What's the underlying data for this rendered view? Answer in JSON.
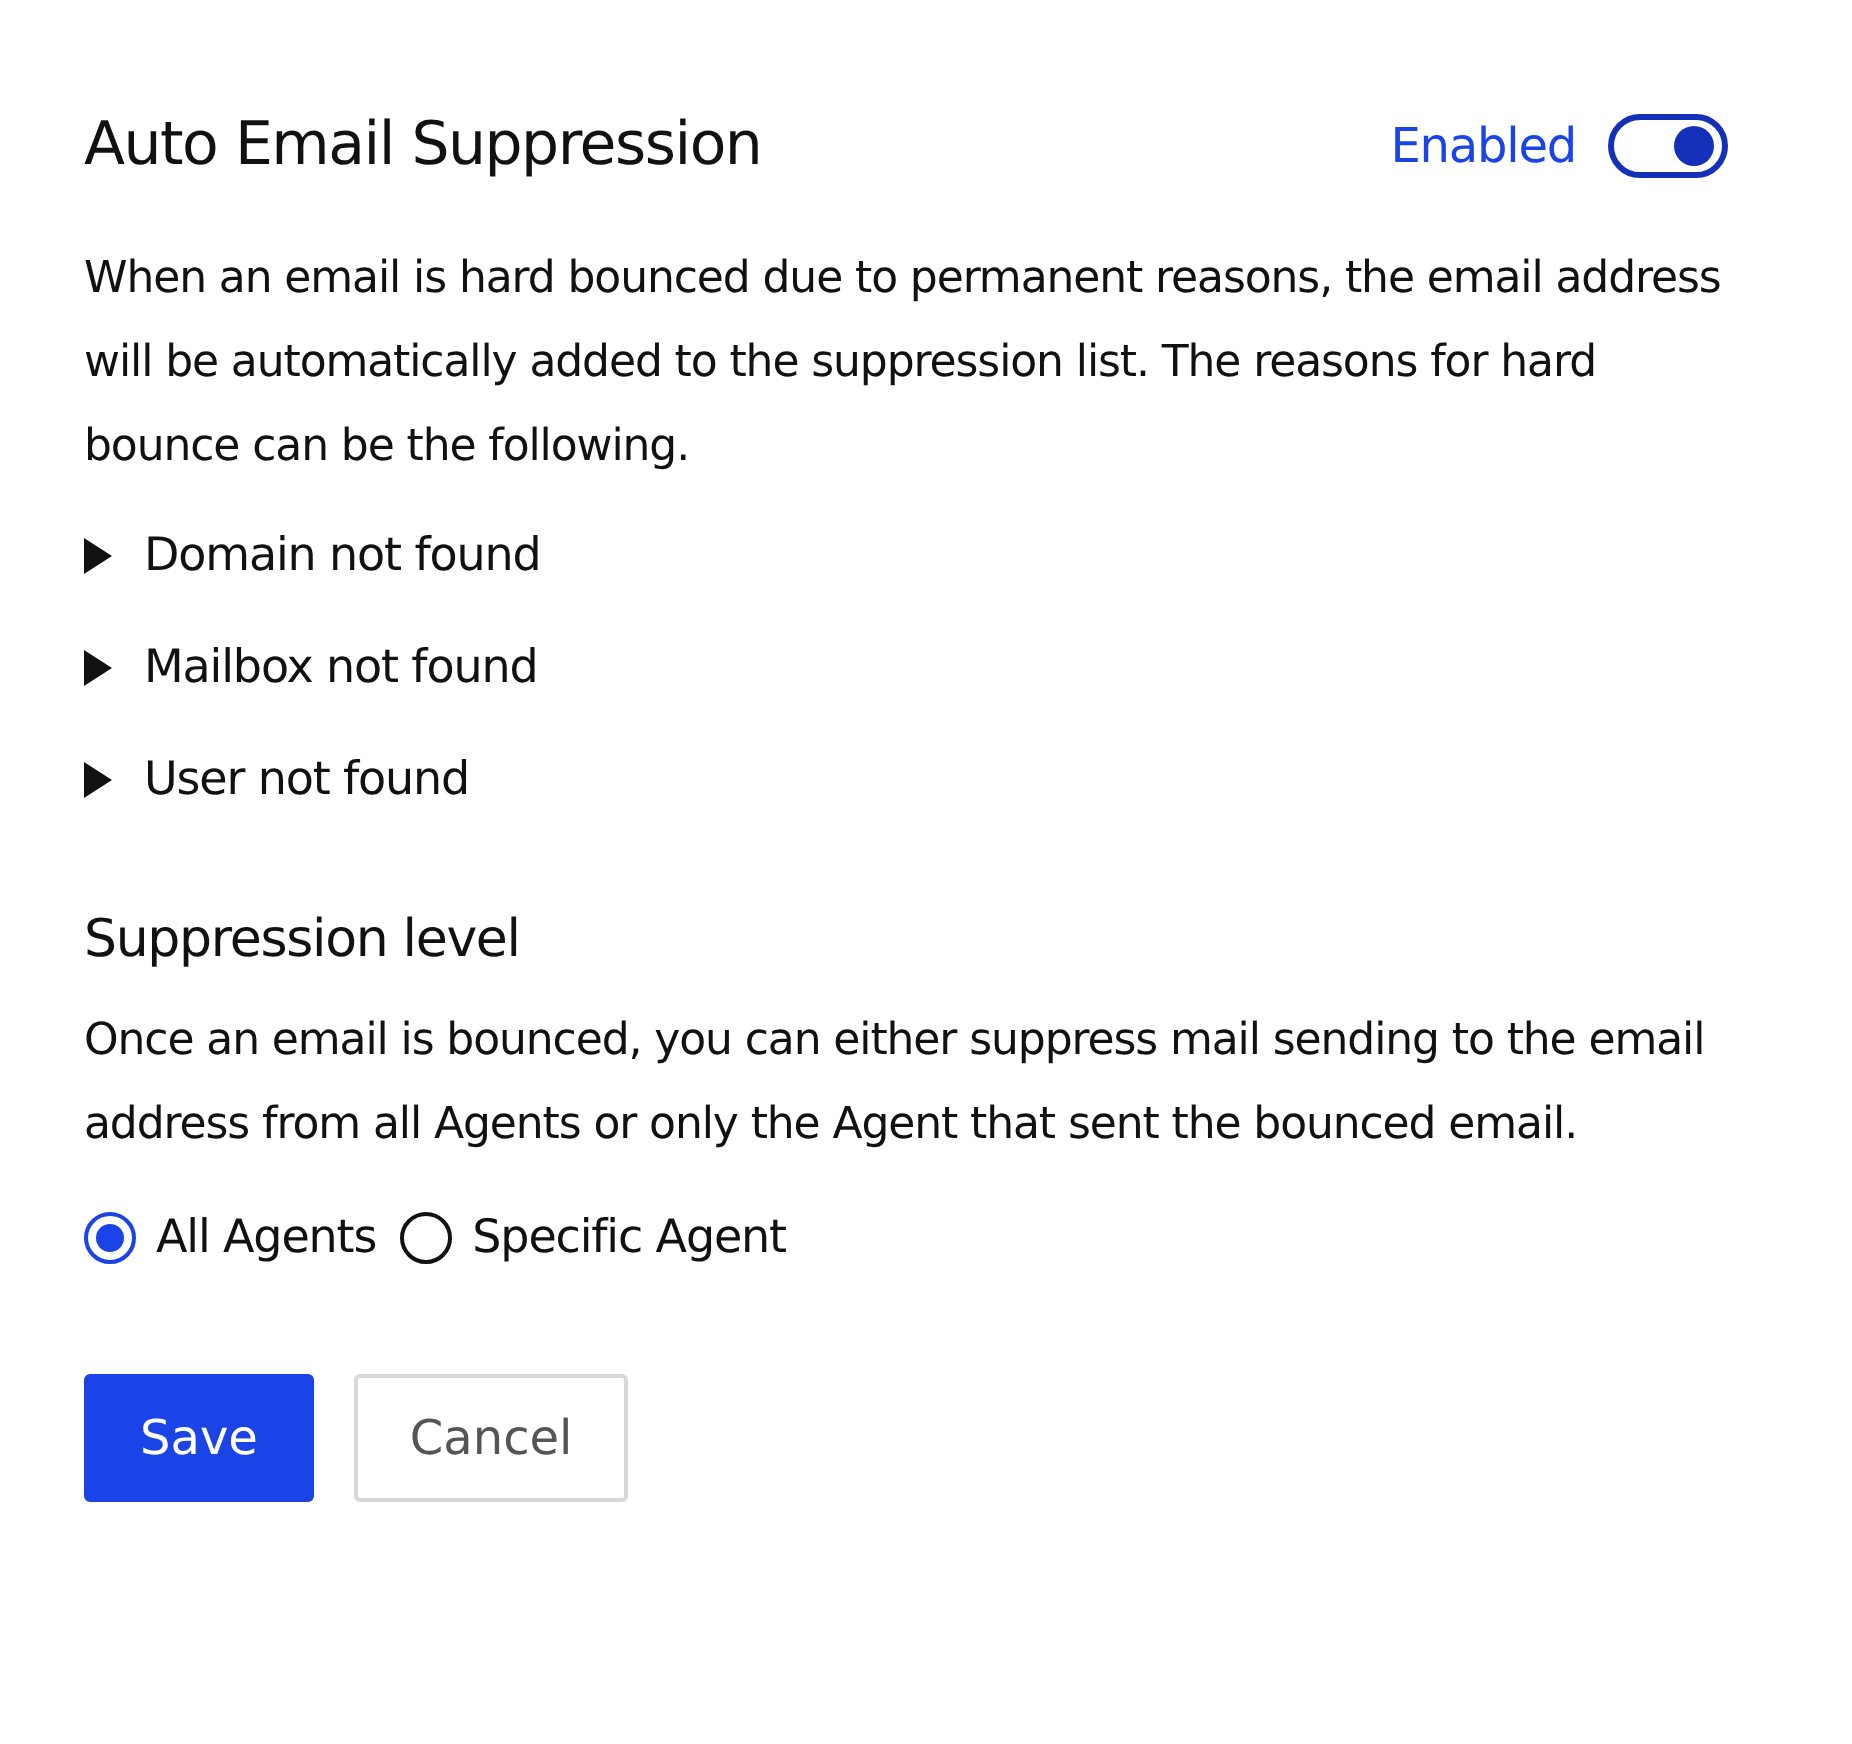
{
  "header": {
    "title": "Auto Email Suppression",
    "status_label": "Enabled",
    "toggle_on": true
  },
  "description": "When an email is hard bounced due to permanent reasons, the email address will be automatically added to the suppression list. The reasons for hard bounce can be the following.",
  "reasons": [
    "Domain not found",
    "Mailbox not found",
    "User not found"
  ],
  "level_section": {
    "title": "Suppression level",
    "description": "Once an email is bounced, you can either suppress mail sending to the email address from all Agents or only the Agent that sent the bounced email."
  },
  "options": [
    {
      "label": "All Agents",
      "selected": true
    },
    {
      "label": "Specific Agent",
      "selected": false
    }
  ],
  "buttons": [
    {
      "label": "Save",
      "kind": "primary"
    },
    {
      "label": "Cancel",
      "kind": "secondary"
    }
  ]
}
